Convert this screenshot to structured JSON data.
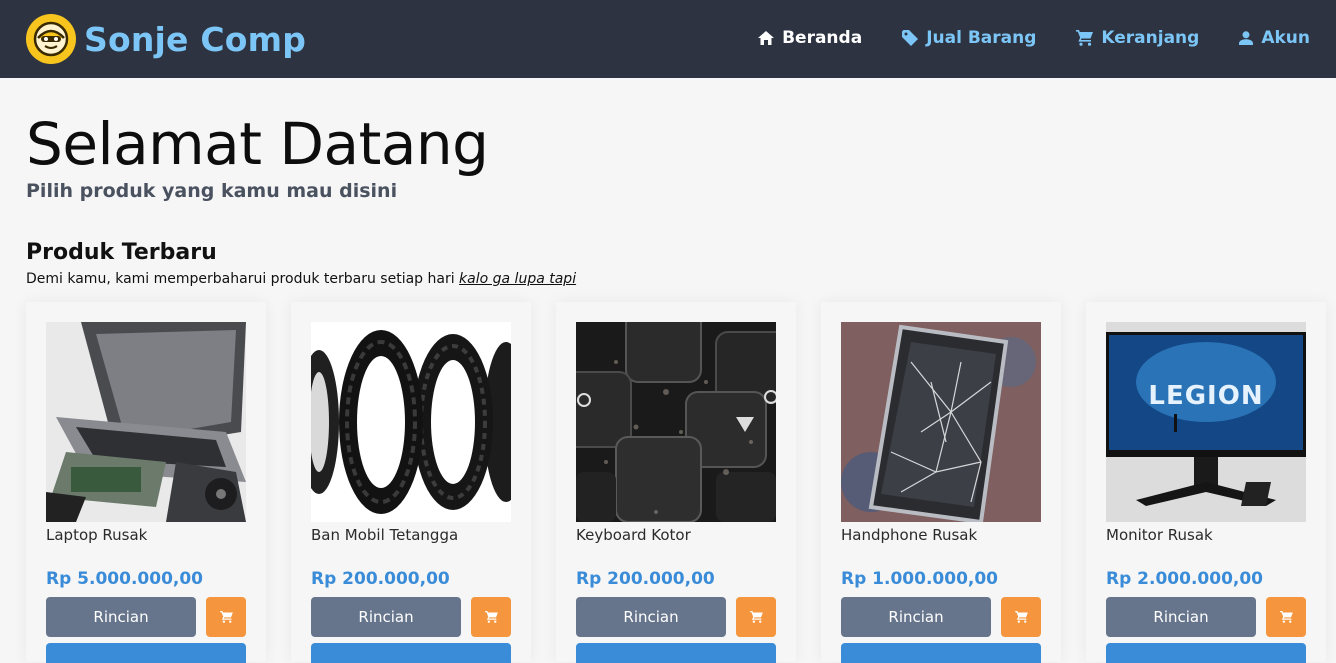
{
  "brand": {
    "name": "Sonje Comp"
  },
  "nav": {
    "items": [
      {
        "label": "Beranda",
        "icon": "home-icon",
        "active": true
      },
      {
        "label": "Jual Barang",
        "icon": "tag-icon",
        "active": false
      },
      {
        "label": "Keranjang",
        "icon": "cart-icon",
        "active": false
      },
      {
        "label": "Akun",
        "icon": "user-icon",
        "active": false
      }
    ]
  },
  "hero": {
    "title": "Selamat Datang",
    "subtitle": "Pilih produk yang kamu mau disini"
  },
  "section": {
    "title": "Produk Terbaru",
    "description": "Demi kamu, kami memperbaharui produk terbaru setiap hari ",
    "description_link": "kalo ga lupa tapi"
  },
  "products": [
    {
      "name": "Laptop Rusak",
      "price": "Rp 5.000.000,00",
      "detail_label": "Rincian"
    },
    {
      "name": "Ban Mobil Tetangga",
      "price": "Rp 200.000,00",
      "detail_label": "Rincian"
    },
    {
      "name": "Keyboard Kotor",
      "price": "Rp 200.000,00",
      "detail_label": "Rincian"
    },
    {
      "name": "Handphone Rusak",
      "price": "Rp 1.000.000,00",
      "detail_label": "Rincian"
    },
    {
      "name": "Monitor Rusak",
      "price": "Rp 2.000.000,00",
      "detail_label": "Rincian"
    }
  ],
  "monitor_image_text": "LEGION",
  "colors": {
    "navbar": "#2d3340",
    "brand": "#7cc6f7",
    "price": "#3a8cd8",
    "detail_button": "#66758c",
    "cart_button": "#f5953d"
  }
}
